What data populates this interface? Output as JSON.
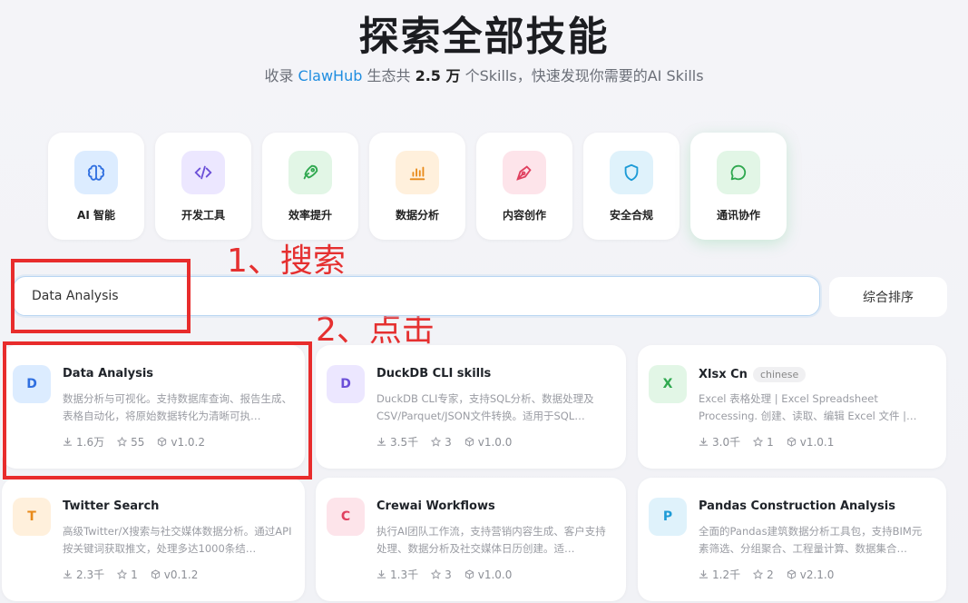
{
  "hero": {
    "title": "探索全部技能",
    "sub_prefix": "收录",
    "sub_brand": "ClawHub",
    "sub_mid": "生态共",
    "sub_count": "2.5 万",
    "sub_suffix": "个Skills，快速发现你需要的AI Skills"
  },
  "categories": [
    {
      "label": "AI 智能",
      "icon": "brain-icon",
      "bg": "#dcecff",
      "color": "#2f6fe0"
    },
    {
      "label": "开发工具",
      "icon": "code-icon",
      "bg": "#ece7ff",
      "color": "#6b4fd8"
    },
    {
      "label": "效率提升",
      "icon": "rocket-icon",
      "bg": "#e2f6e6",
      "color": "#2fa84f"
    },
    {
      "label": "数据分析",
      "icon": "chart-icon",
      "bg": "#fff0dc",
      "color": "#e88a1a"
    },
    {
      "label": "内容创作",
      "icon": "pen-icon",
      "bg": "#fde4ea",
      "color": "#e0405f"
    },
    {
      "label": "安全合规",
      "icon": "shield-icon",
      "bg": "#dff2fb",
      "color": "#1d9bd6"
    },
    {
      "label": "通讯协作",
      "icon": "chat-icon",
      "bg": "#e2f6e6",
      "color": "#2fa84f"
    }
  ],
  "annotations": {
    "step1": "1、搜索",
    "step2": "2、点击"
  },
  "search": {
    "value": "Data Analysis"
  },
  "sort": {
    "label": "综合排序"
  },
  "cards": [
    {
      "letter": "D",
      "title": "Data Analysis",
      "tag": "",
      "desc": "数据分析与可视化。支持数据库查询、报告生成、表格自动化，将原始数据转化为清晰可执…",
      "downloads": "1.6万",
      "stars": "55",
      "version": "v1.0.2",
      "bg": "#dcecff",
      "color": "#2f6fe0"
    },
    {
      "letter": "D",
      "title": "DuckDB CLI skills",
      "tag": "",
      "desc": "DuckDB CLI专家，支持SQL分析、数据处理及CSV/Parquet/JSON文件转换。适用于SQL…",
      "downloads": "3.5千",
      "stars": "3",
      "version": "v1.0.0",
      "bg": "#ece7ff",
      "color": "#6b4fd8"
    },
    {
      "letter": "X",
      "title": "Xlsx Cn",
      "tag": "chinese",
      "desc": "Excel 表格处理 | Excel Spreadsheet Processing. 创建、读取、编辑 Excel 文件 |…",
      "downloads": "3.0千",
      "stars": "1",
      "version": "v1.0.1",
      "bg": "#e2f6e6",
      "color": "#2fa84f"
    },
    {
      "letter": "T",
      "title": "Twitter Search",
      "tag": "",
      "desc": "高级Twitter/X搜索与社交媒体数据分析。通过API按关键词获取推文，处理多达1000条结…",
      "downloads": "2.3千",
      "stars": "1",
      "version": "v0.1.2",
      "bg": "#fff0dc",
      "color": "#e88a1a"
    },
    {
      "letter": "C",
      "title": "Crewai Workflows",
      "tag": "",
      "desc": "执行AI团队工作流，支持营销内容生成、客户支持处理、数据分析及社交媒体日历创建。适…",
      "downloads": "1.3千",
      "stars": "3",
      "version": "v1.0.0",
      "bg": "#fde4ea",
      "color": "#e0405f"
    },
    {
      "letter": "P",
      "title": "Pandas Construction Analysis",
      "tag": "",
      "desc": "全面的Pandas建筑数据分析工具包，支持BIM元素筛选、分组聚合、工程量计算、数据集合…",
      "downloads": "1.2千",
      "stars": "2",
      "version": "v2.1.0",
      "bg": "#dff2fb",
      "color": "#1d9bd6"
    }
  ]
}
